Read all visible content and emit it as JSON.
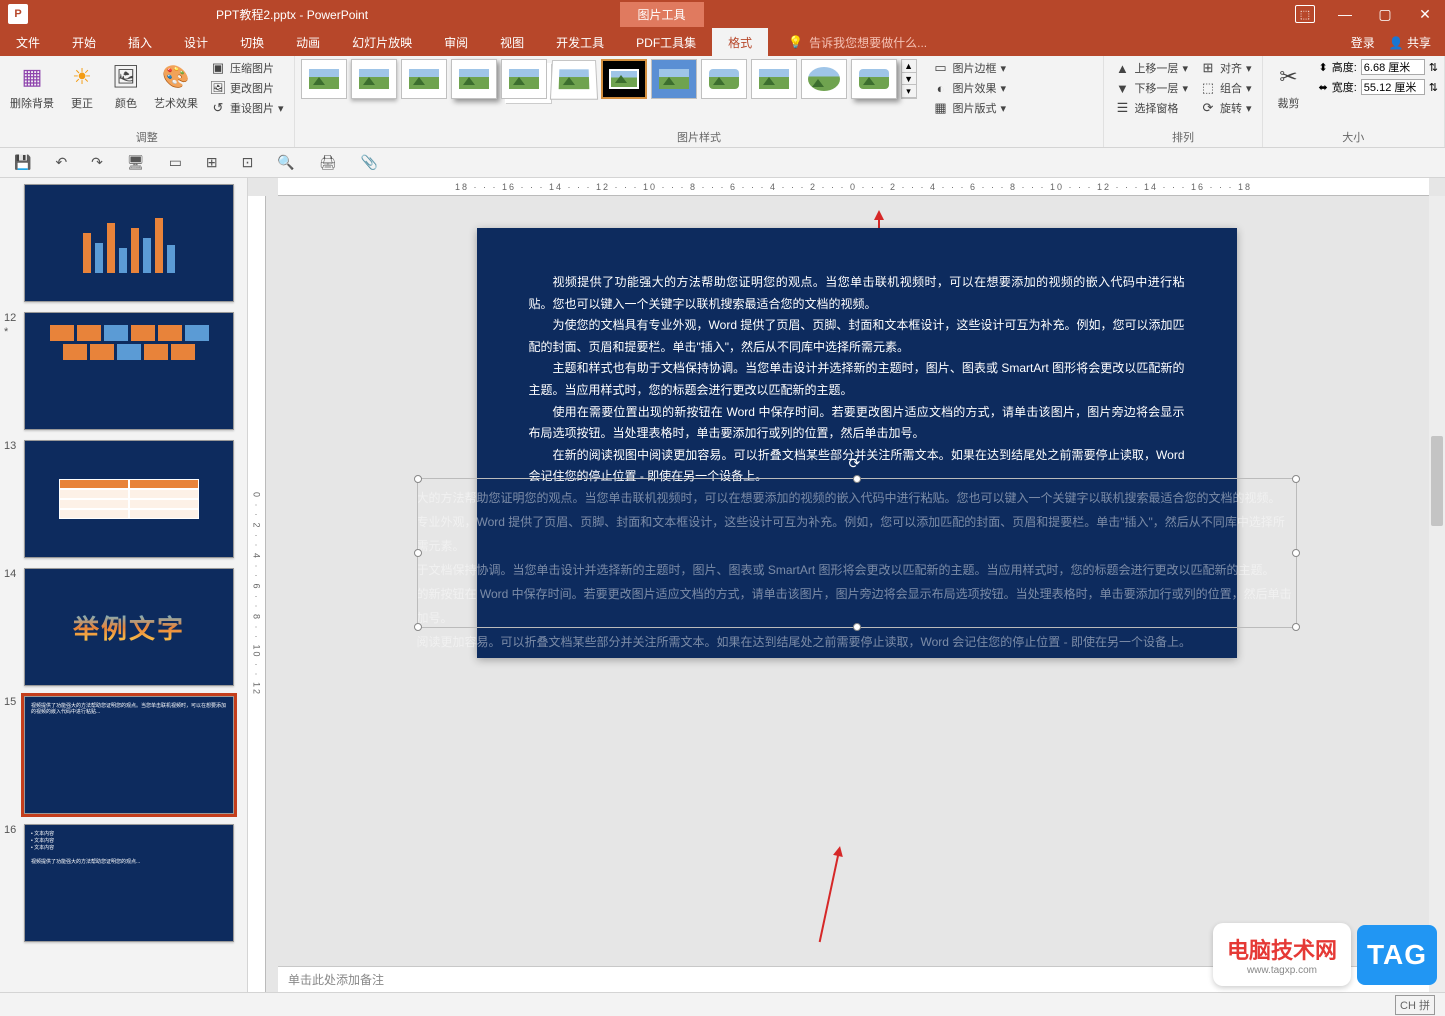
{
  "title": {
    "filename": "PPT教程2.pptx - PowerPoint",
    "context_tab": "图片工具"
  },
  "window_buttons": {
    "minimize": "—",
    "maximize": "▢",
    "close": "✕"
  },
  "ribbon_tabs": [
    "文件",
    "开始",
    "插入",
    "设计",
    "切换",
    "动画",
    "幻灯片放映",
    "审阅",
    "视图",
    "开发工具",
    "PDF工具集",
    "格式"
  ],
  "active_tab": "格式",
  "tell_me_icon": "💡",
  "tell_me": "告诉我您想要做什么...",
  "ribbon_right": {
    "login": "登录",
    "share": "共享"
  },
  "ribbon": {
    "adjust": {
      "remove_bg": "删除背景",
      "corrections": "更正",
      "color": "颜色",
      "artistic": "艺术效果",
      "compress": "压缩图片",
      "change": "更改图片",
      "reset": "重设图片",
      "label": "调整"
    },
    "styles": {
      "border": "图片边框",
      "effects": "图片效果",
      "layout": "图片版式",
      "label": "图片样式"
    },
    "arrange": {
      "forward": "上移一层",
      "backward": "下移一层",
      "selection": "选择窗格",
      "align": "对齐",
      "group": "组合",
      "rotate": "旋转",
      "label": "排列"
    },
    "size": {
      "crop": "裁剪",
      "height_label": "高度:",
      "height_value": "6.68 厘米",
      "width_label": "宽度:",
      "width_value": "55.12 厘米",
      "label": "大小"
    }
  },
  "qat": {
    "save": "💾",
    "undo": "↶",
    "redo": "↷"
  },
  "ruler_text": "18 · · · 16 · · · 14 · · · 12 · · · 10 · · · 8 · · · 6 · · · 4 · · · 2 · · · 0 · · · 2 · · · 4 · · · 6 · · · 8 · · · 10 · · · 12 · · · 14 · · · 16 · · · 18",
  "ruler_v_text": "0 · · 2 · · 4 · · 6 · · 8 · · 10 · · 12",
  "thumbs": {
    "n12": "12",
    "n13": "13",
    "n14": "14",
    "n15": "15",
    "n16": "16",
    "wordart": "举例文字"
  },
  "slide_text": {
    "p1": "视频提供了功能强大的方法帮助您证明您的观点。当您单击联机视频时，可以在想要添加的视频的嵌入代码中进行粘贴。您也可以键入一个关键字以联机搜索最适合您的文档的视频。",
    "p2": "为使您的文档具有专业外观，Word 提供了页眉、页脚、封面和文本框设计，这些设计可互为补充。例如，您可以添加匹配的封面、页眉和提要栏。单击\"插入\"，然后从不同库中选择所需元素。",
    "p3": "主题和样式也有助于文档保持协调。当您单击设计并选择新的主题时，图片、图表或 SmartArt 图形将会更改以匹配新的主题。当应用样式时，您的标题会进行更改以匹配新的主题。",
    "p4": "使用在需要位置出现的新按钮在 Word 中保存时间。若要更改图片适应文档的方式，请单击该图片，图片旁边将会显示布局选项按钮。当处理表格时，单击要添加行或列的位置，然后单击加号。",
    "p5": "在新的阅读视图中阅读更加容易。可以折叠文档某些部分并关注所需文本。如果在达到结尾处之前需要停止读取，Word 会记住您的停止位置 - 即使在另一个设备上。"
  },
  "ghost_text": {
    "g1": "大的方法帮助您证明您的观点。当您单击联机视频时，可以在想要添加的视频的嵌入代码中进行粘贴。您也可以键入一个关键字以联机搜索最适合您的文档的视频。",
    "g2": "专业外观，Word 提供了页眉、页脚、封面和文本框设计，这些设计可互为补充。例如，您可以添加匹配的封面、页眉和提要栏。单击\"插入\"，然后从不同库中选择所需元素。",
    "g3": "于文档保持协调。当您单击设计并选择新的主题时，图片、图表或 SmartArt 图形将会更改以匹配新的主题。当应用样式时，您的标题会进行更改以匹配新的主题。",
    "g4": "的新按钮在 Word 中保存时间。若要更改图片适应文档的方式，请单击该图片，图片旁边将会显示布局选项按钮。当处理表格时，单击要添加行或列的位置，然后单击加号。",
    "g5": "阅读更加容易。可以折叠文档某些部分并关注所需文本。如果在达到结尾处之前需要停止读取，Word 会记住您的停止位置 - 即使在另一个设备上。"
  },
  "notes_placeholder": "单击此处添加备注",
  "statusbar": {
    "lang": "中文",
    "ime": "拼"
  },
  "watermark": {
    "line1": "电脑技术网",
    "line2": "www.tagxp.com",
    "tag": "TAG"
  }
}
